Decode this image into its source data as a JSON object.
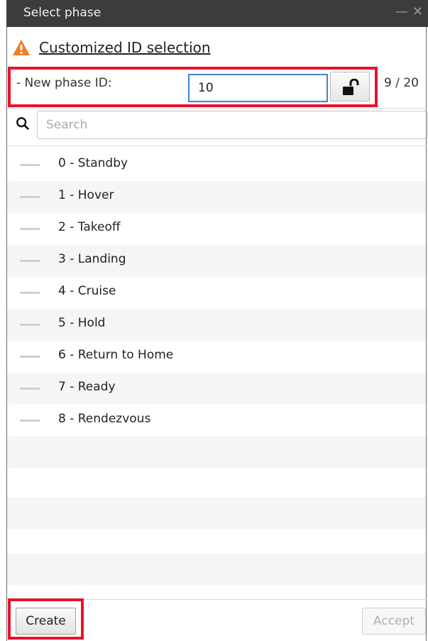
{
  "window": {
    "title": "Select phase",
    "controls": {
      "minimize": "—",
      "close": "✕"
    }
  },
  "warning": {
    "icon": "warning-triangle-icon",
    "link_text": "Customized ID selection",
    "color": "#f47c20"
  },
  "new_phase": {
    "label": "- New phase ID:",
    "value": "10",
    "lock_icon": "unlocked-padlock-icon",
    "count": "9 / 20"
  },
  "search": {
    "icon": "search-icon",
    "placeholder": "Search"
  },
  "phases": [
    {
      "label": "0 - Standby"
    },
    {
      "label": "1 - Hover"
    },
    {
      "label": "2 - Takeoff"
    },
    {
      "label": "3 - Landing"
    },
    {
      "label": "4 - Cruise"
    },
    {
      "label": "5 - Hold"
    },
    {
      "label": "6 - Return to Home"
    },
    {
      "label": "7 - Ready"
    },
    {
      "label": "8 - Rendezvous"
    }
  ],
  "footer": {
    "create_label": "Create",
    "accept_label": "Accept"
  },
  "colors": {
    "highlight": "#e8112d",
    "titlebar": "#3c3c3c",
    "input_focus": "#3a86d4"
  }
}
